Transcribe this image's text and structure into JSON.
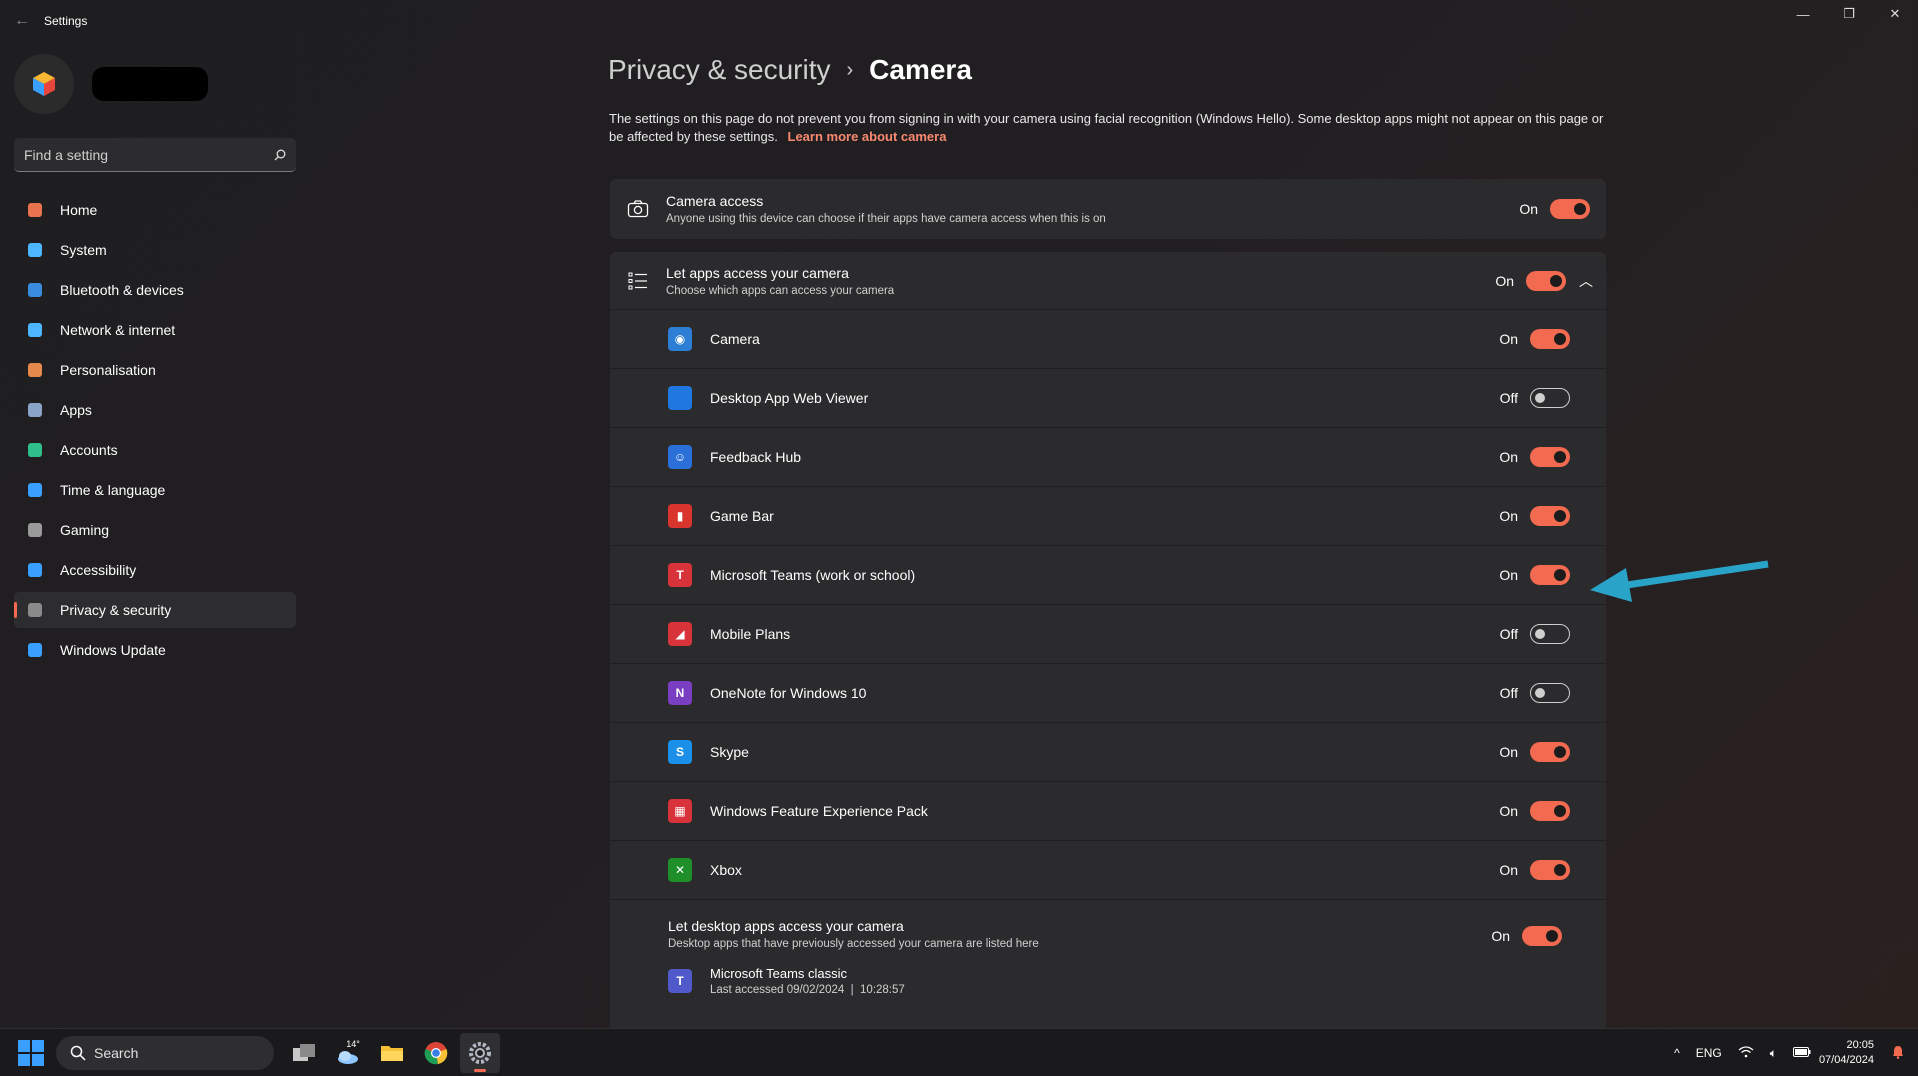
{
  "window": {
    "title": "Settings",
    "back_icon": "back-arrow-icon",
    "controls": [
      "minimize-icon",
      "restore-icon",
      "close-icon"
    ]
  },
  "sidebar": {
    "search_placeholder": "Find a setting",
    "items": [
      {
        "label": "Home",
        "icon": "home-icon",
        "color": "#e8734f"
      },
      {
        "label": "System",
        "icon": "monitor-icon",
        "color": "#4cb7ff"
      },
      {
        "label": "Bluetooth & devices",
        "icon": "bluetooth-icon",
        "color": "#3a8dde"
      },
      {
        "label": "Network & internet",
        "icon": "wifi-icon",
        "color": "#4cb7ff"
      },
      {
        "label": "Personalisation",
        "icon": "brush-icon",
        "color": "#e58a4c"
      },
      {
        "label": "Apps",
        "icon": "apps-icon",
        "color": "#8aa4c8"
      },
      {
        "label": "Accounts",
        "icon": "person-icon",
        "color": "#2fbf8a"
      },
      {
        "label": "Time & language",
        "icon": "globe-clock-icon",
        "color": "#3aa0ff"
      },
      {
        "label": "Gaming",
        "icon": "gamepad-icon",
        "color": "#9a9a9a"
      },
      {
        "label": "Accessibility",
        "icon": "accessibility-icon",
        "color": "#3aa0ff"
      },
      {
        "label": "Privacy & security",
        "icon": "shield-icon",
        "color": "#8a8a8a",
        "active": true
      },
      {
        "label": "Windows Update",
        "icon": "update-icon",
        "color": "#3aa0ff"
      }
    ]
  },
  "header": {
    "parent": "Privacy & security",
    "separator": "›",
    "current": "Camera"
  },
  "description": {
    "text": "The settings on this page do not prevent you from signing in with your camera using facial recognition (Windows Hello). Some desktop apps might not appear on this page or be affected by these settings.",
    "link": "Learn more about camera"
  },
  "camera_access": {
    "title": "Camera access",
    "subtitle": "Anyone using this device can choose if their apps have camera access when this is on",
    "state": "On",
    "on": true
  },
  "let_apps": {
    "title": "Let apps access your camera",
    "subtitle": "Choose which apps can access your camera",
    "state": "On",
    "on": true,
    "expanded_icon": "chevron-up-icon"
  },
  "apps": [
    {
      "name": "Camera",
      "state": "On",
      "on": true,
      "icon_color": "#2d7fd6",
      "glyph": "◉"
    },
    {
      "name": "Desktop App Web Viewer",
      "state": "Off",
      "on": false,
      "icon_color": "#1f78e0",
      "glyph": ""
    },
    {
      "name": "Feedback Hub",
      "state": "On",
      "on": true,
      "icon_color": "#2b6fd8",
      "glyph": "☺"
    },
    {
      "name": "Game Bar",
      "state": "On",
      "on": true,
      "icon_color": "#d9352c",
      "glyph": "▮"
    },
    {
      "name": "Microsoft Teams (work or school)",
      "state": "On",
      "on": true,
      "icon_color": "#d8323a",
      "glyph": "T"
    },
    {
      "name": "Mobile Plans",
      "state": "Off",
      "on": false,
      "icon_color": "#d8323a",
      "glyph": "◢"
    },
    {
      "name": "OneNote for Windows 10",
      "state": "Off",
      "on": false,
      "icon_color": "#7a3ec2",
      "glyph": "N"
    },
    {
      "name": "Skype",
      "state": "On",
      "on": true,
      "icon_color": "#1c90e8",
      "glyph": "S"
    },
    {
      "name": "Windows Feature Experience Pack",
      "state": "On",
      "on": true,
      "icon_color": "#d8323a",
      "glyph": "▦"
    },
    {
      "name": "Xbox",
      "state": "On",
      "on": true,
      "icon_color": "#1f8f2a",
      "glyph": "✕"
    }
  ],
  "desktop_apps": {
    "title": "Let desktop apps access your camera",
    "subtitle": "Desktop apps that have previously accessed your camera are listed here",
    "state": "On",
    "on": true,
    "entry_name": "Microsoft Teams classic",
    "entry_access": "Last accessed 09/02/2024  |  10:28:57"
  },
  "annotation": {
    "icon": "blue-arrow-icon",
    "color": "#2aa3c8"
  },
  "taskbar": {
    "search_placeholder": "Search",
    "weather": "14°",
    "apps": [
      "task-view-icon",
      "weather-icon",
      "file-explorer-icon",
      "chrome-icon",
      "settings-icon"
    ],
    "tray": {
      "chevron": "^",
      "language": "ENG",
      "time": "20:05",
      "date": "07/04/2024"
    }
  },
  "colors": {
    "accent": "#f26a4f",
    "link": "#f9896f",
    "card": "#2b2a2c"
  }
}
